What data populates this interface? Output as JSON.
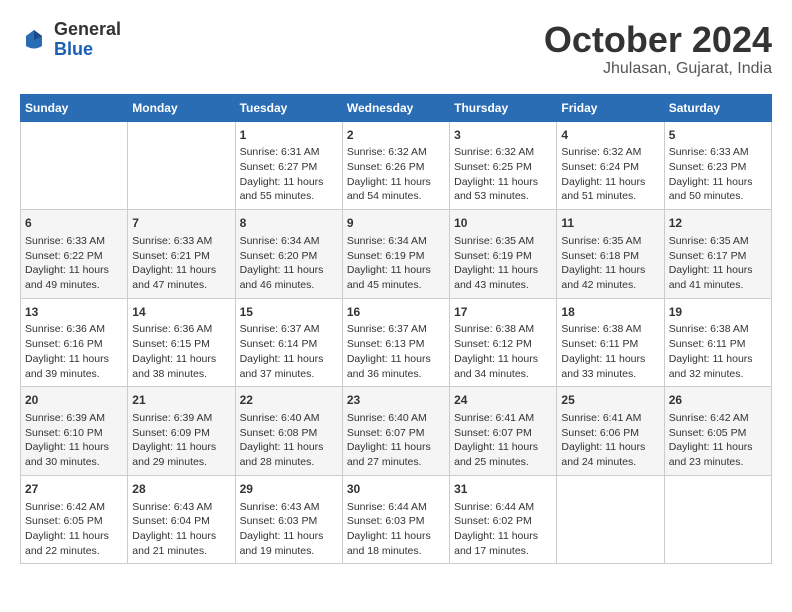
{
  "header": {
    "logo_line1": "General",
    "logo_line2": "Blue",
    "title": "October 2024",
    "subtitle": "Jhulasan, Gujarat, India"
  },
  "columns": [
    "Sunday",
    "Monday",
    "Tuesday",
    "Wednesday",
    "Thursday",
    "Friday",
    "Saturday"
  ],
  "weeks": [
    [
      {
        "day": "",
        "info": ""
      },
      {
        "day": "",
        "info": ""
      },
      {
        "day": "1",
        "info": "Sunrise: 6:31 AM\nSunset: 6:27 PM\nDaylight: 11 hours and 55 minutes."
      },
      {
        "day": "2",
        "info": "Sunrise: 6:32 AM\nSunset: 6:26 PM\nDaylight: 11 hours and 54 minutes."
      },
      {
        "day": "3",
        "info": "Sunrise: 6:32 AM\nSunset: 6:25 PM\nDaylight: 11 hours and 53 minutes."
      },
      {
        "day": "4",
        "info": "Sunrise: 6:32 AM\nSunset: 6:24 PM\nDaylight: 11 hours and 51 minutes."
      },
      {
        "day": "5",
        "info": "Sunrise: 6:33 AM\nSunset: 6:23 PM\nDaylight: 11 hours and 50 minutes."
      }
    ],
    [
      {
        "day": "6",
        "info": "Sunrise: 6:33 AM\nSunset: 6:22 PM\nDaylight: 11 hours and 49 minutes."
      },
      {
        "day": "7",
        "info": "Sunrise: 6:33 AM\nSunset: 6:21 PM\nDaylight: 11 hours and 47 minutes."
      },
      {
        "day": "8",
        "info": "Sunrise: 6:34 AM\nSunset: 6:20 PM\nDaylight: 11 hours and 46 minutes."
      },
      {
        "day": "9",
        "info": "Sunrise: 6:34 AM\nSunset: 6:19 PM\nDaylight: 11 hours and 45 minutes."
      },
      {
        "day": "10",
        "info": "Sunrise: 6:35 AM\nSunset: 6:19 PM\nDaylight: 11 hours and 43 minutes."
      },
      {
        "day": "11",
        "info": "Sunrise: 6:35 AM\nSunset: 6:18 PM\nDaylight: 11 hours and 42 minutes."
      },
      {
        "day": "12",
        "info": "Sunrise: 6:35 AM\nSunset: 6:17 PM\nDaylight: 11 hours and 41 minutes."
      }
    ],
    [
      {
        "day": "13",
        "info": "Sunrise: 6:36 AM\nSunset: 6:16 PM\nDaylight: 11 hours and 39 minutes."
      },
      {
        "day": "14",
        "info": "Sunrise: 6:36 AM\nSunset: 6:15 PM\nDaylight: 11 hours and 38 minutes."
      },
      {
        "day": "15",
        "info": "Sunrise: 6:37 AM\nSunset: 6:14 PM\nDaylight: 11 hours and 37 minutes."
      },
      {
        "day": "16",
        "info": "Sunrise: 6:37 AM\nSunset: 6:13 PM\nDaylight: 11 hours and 36 minutes."
      },
      {
        "day": "17",
        "info": "Sunrise: 6:38 AM\nSunset: 6:12 PM\nDaylight: 11 hours and 34 minutes."
      },
      {
        "day": "18",
        "info": "Sunrise: 6:38 AM\nSunset: 6:11 PM\nDaylight: 11 hours and 33 minutes."
      },
      {
        "day": "19",
        "info": "Sunrise: 6:38 AM\nSunset: 6:11 PM\nDaylight: 11 hours and 32 minutes."
      }
    ],
    [
      {
        "day": "20",
        "info": "Sunrise: 6:39 AM\nSunset: 6:10 PM\nDaylight: 11 hours and 30 minutes."
      },
      {
        "day": "21",
        "info": "Sunrise: 6:39 AM\nSunset: 6:09 PM\nDaylight: 11 hours and 29 minutes."
      },
      {
        "day": "22",
        "info": "Sunrise: 6:40 AM\nSunset: 6:08 PM\nDaylight: 11 hours and 28 minutes."
      },
      {
        "day": "23",
        "info": "Sunrise: 6:40 AM\nSunset: 6:07 PM\nDaylight: 11 hours and 27 minutes."
      },
      {
        "day": "24",
        "info": "Sunrise: 6:41 AM\nSunset: 6:07 PM\nDaylight: 11 hours and 25 minutes."
      },
      {
        "day": "25",
        "info": "Sunrise: 6:41 AM\nSunset: 6:06 PM\nDaylight: 11 hours and 24 minutes."
      },
      {
        "day": "26",
        "info": "Sunrise: 6:42 AM\nSunset: 6:05 PM\nDaylight: 11 hours and 23 minutes."
      }
    ],
    [
      {
        "day": "27",
        "info": "Sunrise: 6:42 AM\nSunset: 6:05 PM\nDaylight: 11 hours and 22 minutes."
      },
      {
        "day": "28",
        "info": "Sunrise: 6:43 AM\nSunset: 6:04 PM\nDaylight: 11 hours and 21 minutes."
      },
      {
        "day": "29",
        "info": "Sunrise: 6:43 AM\nSunset: 6:03 PM\nDaylight: 11 hours and 19 minutes."
      },
      {
        "day": "30",
        "info": "Sunrise: 6:44 AM\nSunset: 6:03 PM\nDaylight: 11 hours and 18 minutes."
      },
      {
        "day": "31",
        "info": "Sunrise: 6:44 AM\nSunset: 6:02 PM\nDaylight: 11 hours and 17 minutes."
      },
      {
        "day": "",
        "info": ""
      },
      {
        "day": "",
        "info": ""
      }
    ]
  ]
}
